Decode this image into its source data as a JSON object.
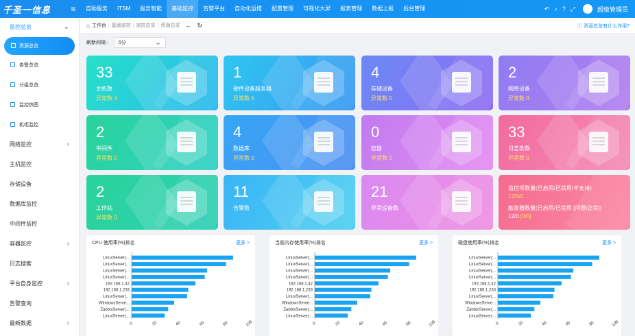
{
  "logo": "千圣一信息",
  "nav": [
    "自助服务",
    "ITSM",
    "服务智能",
    "基础监控",
    "告警平台",
    "自动化运维",
    "配置管理",
    "可视化大屏",
    "报表管理",
    "数据上报",
    "后台管理"
  ],
  "nav_active": 3,
  "user": "超级管理员",
  "sidebar": {
    "group": "监控总览",
    "subs": [
      "资源总览",
      "告警总览",
      "分组总览",
      "监控热图",
      "机柜监控"
    ],
    "items": [
      {
        "label": "网络监控",
        "chev": true
      },
      {
        "label": "主机监控",
        "chev": false
      },
      {
        "label": "存储设备",
        "chev": false
      },
      {
        "label": "数据库监控",
        "chev": false
      },
      {
        "label": "中间件监控",
        "chev": false
      },
      {
        "label": "容器监控",
        "chev": true
      },
      {
        "label": "日志搜索",
        "chev": false
      },
      {
        "label": "平台自身监控",
        "chev": true
      },
      {
        "label": "告警查询",
        "chev": false
      },
      {
        "label": "最新数据",
        "chev": true
      }
    ]
  },
  "breadcrumb": {
    "home": "工作台",
    "items": [
      "基础监控",
      "监控总览"
    ],
    "current": "资源总览"
  },
  "help": "资源总览有什么作用?",
  "refresh": {
    "label": "刷新间隔 :",
    "value": "5分"
  },
  "cards": [
    {
      "num": "33",
      "label": "主机数",
      "sub": "异常数 4",
      "c1": "#26e0c8",
      "c2": "#2bb8f0"
    },
    {
      "num": "1",
      "label": "硬件设备服务器",
      "sub": "异常数 0",
      "c1": "#2fc6f0",
      "c2": "#3a98f2"
    },
    {
      "num": "4",
      "label": "存储设备",
      "sub": "异常数 0",
      "c1": "#6a8af5",
      "c2": "#8f6cf2"
    },
    {
      "num": "2",
      "label": "网络设备",
      "sub": "异常数 0",
      "c1": "#8f7cf2",
      "c2": "#b47ef0"
    },
    {
      "num": "2",
      "label": "中间件",
      "sub": "异常数 0",
      "c1": "#2ad39a",
      "c2": "#2fd0c6"
    },
    {
      "num": "4",
      "label": "数据库",
      "sub": "异常数 0",
      "c1": "#36a6f5",
      "c2": "#4d8ff2"
    },
    {
      "num": "0",
      "label": "容器",
      "sub": "异常数 0",
      "c1": "#c07bf0",
      "c2": "#e58df0"
    },
    {
      "num": "33",
      "label": "日志条数",
      "sub": "异常数 0",
      "c1": "#f26aa0",
      "c2": "#f58cb8"
    },
    {
      "num": "2",
      "label": "工作站",
      "sub": "异常数 0",
      "c1": "#2ad39a",
      "c2": "#2fd0b6"
    },
    {
      "num": "11",
      "label": "告警数",
      "sub": "",
      "c1": "#39b5f5",
      "c2": "#4fd0f0"
    },
    {
      "num": "21",
      "label": "异常设备数",
      "sub": "",
      "c1": "#d989f2",
      "c2": "#f08fe2"
    }
  ],
  "summary_card": {
    "line1": "监控项数量(已启用/已禁用/不支持)",
    "line2": "12/0/0",
    "line3": "触发器数量(已启用/已禁用 [问题/正常])",
    "line4a": "12/0 ",
    "line4b": "[0/0]"
  },
  "panels": [
    {
      "title": "CPU 使用率(%)排名",
      "more": "更多 >"
    },
    {
      "title": "当前内存使用率(%)排名",
      "more": "更多 >"
    },
    {
      "title": "磁盘使用率(%)排名",
      "more": "更多 >"
    }
  ],
  "chart_data": [
    {
      "type": "bar",
      "title": "CPU 使用率(%)排名",
      "categories": [
        "LinuxServer(...",
        "LinuxServer(...",
        "LinuxServer(...",
        "LinuxServer(...",
        "192.168.1.42",
        "192.168.1.233",
        "LinuxServer(...",
        "WindowsServe...",
        "ZabbixServer(...",
        "LinuxServer(..."
      ],
      "values": [
        86,
        80,
        64,
        62,
        54,
        48,
        47,
        36,
        31,
        28
      ],
      "xlim": [
        0,
        100
      ],
      "xticks": [
        0,
        20,
        40,
        60,
        80,
        100
      ]
    },
    {
      "type": "bar",
      "title": "当前内存使用率(%)排名",
      "categories": [
        "LinuxServer(...",
        "LinuxServer(...",
        "LinuxServer(...",
        "LinuxServer(...",
        "192.168.1.42",
        "192.168.1.233",
        "LinuxServer(...",
        "WindowsServe...",
        "ZabbixServer(...",
        "LinuxServer(..."
      ],
      "values": [
        86,
        80,
        64,
        62,
        54,
        48,
        47,
        36,
        31,
        28
      ],
      "xlim": [
        0,
        100
      ],
      "xticks": [
        0,
        20,
        40,
        60,
        80,
        100
      ]
    },
    {
      "type": "bar",
      "title": "磁盘使用率(%)排名",
      "categories": [
        "LinuxServer(...",
        "LinuxServer(...",
        "LinuxServer(...",
        "LinuxServer(...",
        "192.168.1.42",
        "192.168.1.233",
        "LinuxServer(...",
        "WindowsServe...",
        "ZabbixServer(...",
        "LinuxServer(..."
      ],
      "values": [
        86,
        80,
        64,
        62,
        54,
        48,
        47,
        36,
        31,
        28
      ],
      "xlim": [
        0,
        100
      ],
      "xticks": [
        0,
        20,
        40,
        60,
        80,
        100
      ]
    }
  ]
}
